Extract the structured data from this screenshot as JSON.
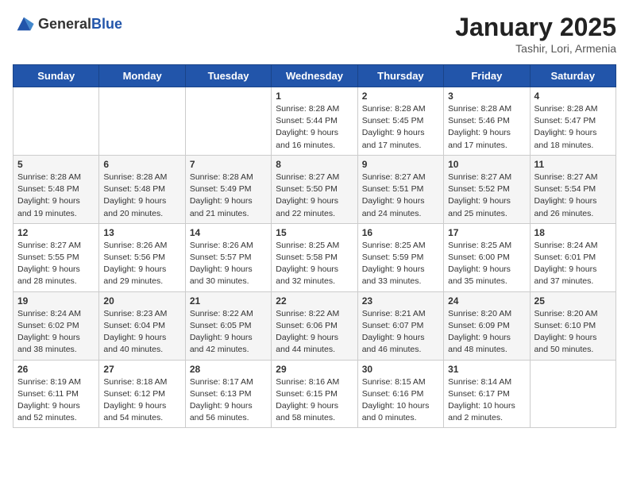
{
  "header": {
    "logo_general": "General",
    "logo_blue": "Blue",
    "month": "January 2025",
    "location": "Tashir, Lori, Armenia"
  },
  "weekdays": [
    "Sunday",
    "Monday",
    "Tuesday",
    "Wednesday",
    "Thursday",
    "Friday",
    "Saturday"
  ],
  "weeks": [
    [
      {
        "day": "",
        "info": ""
      },
      {
        "day": "",
        "info": ""
      },
      {
        "day": "",
        "info": ""
      },
      {
        "day": "1",
        "info": "Sunrise: 8:28 AM\nSunset: 5:44 PM\nDaylight: 9 hours\nand 16 minutes."
      },
      {
        "day": "2",
        "info": "Sunrise: 8:28 AM\nSunset: 5:45 PM\nDaylight: 9 hours\nand 17 minutes."
      },
      {
        "day": "3",
        "info": "Sunrise: 8:28 AM\nSunset: 5:46 PM\nDaylight: 9 hours\nand 17 minutes."
      },
      {
        "day": "4",
        "info": "Sunrise: 8:28 AM\nSunset: 5:47 PM\nDaylight: 9 hours\nand 18 minutes."
      }
    ],
    [
      {
        "day": "5",
        "info": "Sunrise: 8:28 AM\nSunset: 5:48 PM\nDaylight: 9 hours\nand 19 minutes."
      },
      {
        "day": "6",
        "info": "Sunrise: 8:28 AM\nSunset: 5:48 PM\nDaylight: 9 hours\nand 20 minutes."
      },
      {
        "day": "7",
        "info": "Sunrise: 8:28 AM\nSunset: 5:49 PM\nDaylight: 9 hours\nand 21 minutes."
      },
      {
        "day": "8",
        "info": "Sunrise: 8:27 AM\nSunset: 5:50 PM\nDaylight: 9 hours\nand 22 minutes."
      },
      {
        "day": "9",
        "info": "Sunrise: 8:27 AM\nSunset: 5:51 PM\nDaylight: 9 hours\nand 24 minutes."
      },
      {
        "day": "10",
        "info": "Sunrise: 8:27 AM\nSunset: 5:52 PM\nDaylight: 9 hours\nand 25 minutes."
      },
      {
        "day": "11",
        "info": "Sunrise: 8:27 AM\nSunset: 5:54 PM\nDaylight: 9 hours\nand 26 minutes."
      }
    ],
    [
      {
        "day": "12",
        "info": "Sunrise: 8:27 AM\nSunset: 5:55 PM\nDaylight: 9 hours\nand 28 minutes."
      },
      {
        "day": "13",
        "info": "Sunrise: 8:26 AM\nSunset: 5:56 PM\nDaylight: 9 hours\nand 29 minutes."
      },
      {
        "day": "14",
        "info": "Sunrise: 8:26 AM\nSunset: 5:57 PM\nDaylight: 9 hours\nand 30 minutes."
      },
      {
        "day": "15",
        "info": "Sunrise: 8:25 AM\nSunset: 5:58 PM\nDaylight: 9 hours\nand 32 minutes."
      },
      {
        "day": "16",
        "info": "Sunrise: 8:25 AM\nSunset: 5:59 PM\nDaylight: 9 hours\nand 33 minutes."
      },
      {
        "day": "17",
        "info": "Sunrise: 8:25 AM\nSunset: 6:00 PM\nDaylight: 9 hours\nand 35 minutes."
      },
      {
        "day": "18",
        "info": "Sunrise: 8:24 AM\nSunset: 6:01 PM\nDaylight: 9 hours\nand 37 minutes."
      }
    ],
    [
      {
        "day": "19",
        "info": "Sunrise: 8:24 AM\nSunset: 6:02 PM\nDaylight: 9 hours\nand 38 minutes."
      },
      {
        "day": "20",
        "info": "Sunrise: 8:23 AM\nSunset: 6:04 PM\nDaylight: 9 hours\nand 40 minutes."
      },
      {
        "day": "21",
        "info": "Sunrise: 8:22 AM\nSunset: 6:05 PM\nDaylight: 9 hours\nand 42 minutes."
      },
      {
        "day": "22",
        "info": "Sunrise: 8:22 AM\nSunset: 6:06 PM\nDaylight: 9 hours\nand 44 minutes."
      },
      {
        "day": "23",
        "info": "Sunrise: 8:21 AM\nSunset: 6:07 PM\nDaylight: 9 hours\nand 46 minutes."
      },
      {
        "day": "24",
        "info": "Sunrise: 8:20 AM\nSunset: 6:09 PM\nDaylight: 9 hours\nand 48 minutes."
      },
      {
        "day": "25",
        "info": "Sunrise: 8:20 AM\nSunset: 6:10 PM\nDaylight: 9 hours\nand 50 minutes."
      }
    ],
    [
      {
        "day": "26",
        "info": "Sunrise: 8:19 AM\nSunset: 6:11 PM\nDaylight: 9 hours\nand 52 minutes."
      },
      {
        "day": "27",
        "info": "Sunrise: 8:18 AM\nSunset: 6:12 PM\nDaylight: 9 hours\nand 54 minutes."
      },
      {
        "day": "28",
        "info": "Sunrise: 8:17 AM\nSunset: 6:13 PM\nDaylight: 9 hours\nand 56 minutes."
      },
      {
        "day": "29",
        "info": "Sunrise: 8:16 AM\nSunset: 6:15 PM\nDaylight: 9 hours\nand 58 minutes."
      },
      {
        "day": "30",
        "info": "Sunrise: 8:15 AM\nSunset: 6:16 PM\nDaylight: 10 hours\nand 0 minutes."
      },
      {
        "day": "31",
        "info": "Sunrise: 8:14 AM\nSunset: 6:17 PM\nDaylight: 10 hours\nand 2 minutes."
      },
      {
        "day": "",
        "info": ""
      }
    ]
  ]
}
